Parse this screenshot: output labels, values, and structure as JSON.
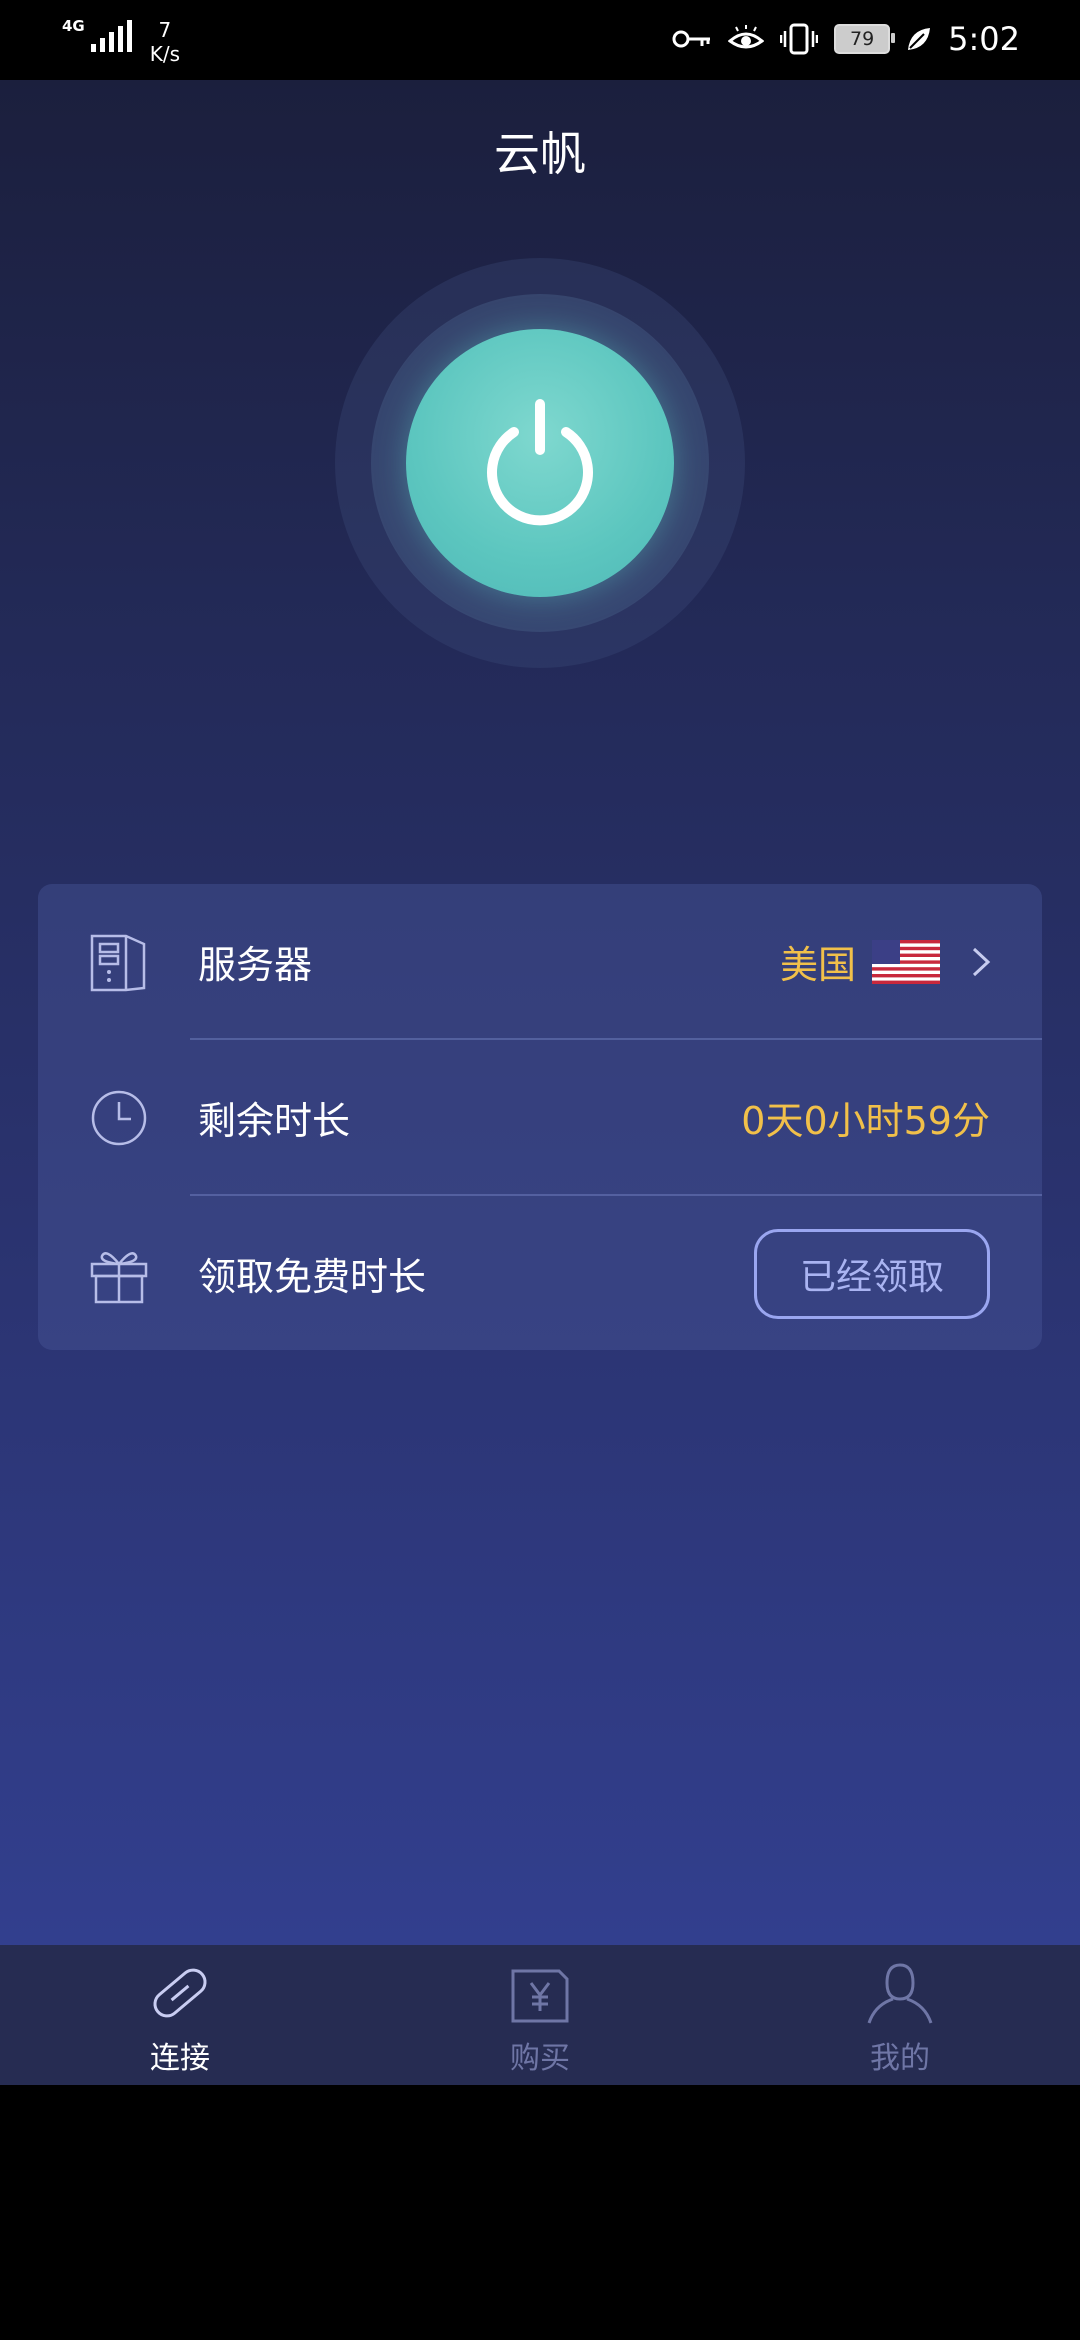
{
  "status_bar": {
    "network": "4G",
    "speed_value": "7",
    "speed_unit": "K/s",
    "battery": "79",
    "time": "5:02",
    "icons": [
      "key-icon",
      "eye-icon",
      "vibrate-icon",
      "battery-icon",
      "leaf-icon"
    ]
  },
  "app": {
    "title": "云帆"
  },
  "card": {
    "server": {
      "label": "服务器",
      "value": "美国",
      "flag": "us-flag-icon"
    },
    "remaining": {
      "label": "剩余时长",
      "value": "0天0小时59分"
    },
    "free_time": {
      "label": "领取免费时长",
      "button": "已经领取"
    }
  },
  "tabs": [
    {
      "label": "连接",
      "icon": "link-icon",
      "active": true
    },
    {
      "label": "购买",
      "icon": "wallet-yen-icon",
      "active": false
    },
    {
      "label": "我的",
      "icon": "user-icon",
      "active": false
    }
  ],
  "colors": {
    "accent_yellow": "#f1c04a",
    "power_teal": "#5cc6bf",
    "tab_bar": "#262c52"
  }
}
